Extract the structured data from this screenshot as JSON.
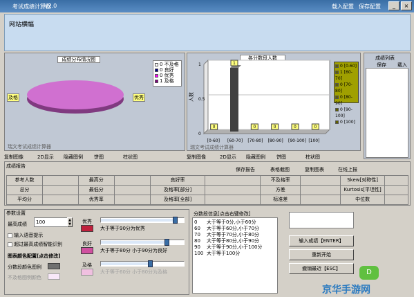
{
  "window": {
    "title": "考试成绩计算器",
    "version": "V2.0",
    "menu_import": "载入配置",
    "menu_save": "保存配置"
  },
  "banner": {
    "text": "网站横幅"
  },
  "pie": {
    "title": "成绩分布情况图",
    "label_left": "及格",
    "label_right": "优秀",
    "credit": "瑞文考试成绩计算器",
    "legend": [
      "0 不及格",
      "0 良好",
      "0 优秀",
      "1 及格"
    ],
    "legend_colors": [
      "#ffffff",
      "#000080",
      "#ff00ff",
      "#800080"
    ],
    "tools": [
      "复制图像",
      "2D显示",
      "隐藏图例",
      "饼图",
      "柱状图"
    ]
  },
  "bar": {
    "title": "各分数段人数",
    "ylabel": "人数",
    "credit": "瑞文考试成绩计算器",
    "tools": [
      "复制图像",
      "2D显示",
      "隐藏图例",
      "饼图",
      "柱状图"
    ]
  },
  "chart_data": {
    "type": "bar",
    "title": "各分数段人数",
    "ylabel": "人数",
    "xlabel": "",
    "categories": [
      "[0-60]",
      "[60-70]",
      "[70-80]",
      "[80-90]",
      "[90-100]",
      "[100]"
    ],
    "values": [
      0,
      1,
      0,
      0,
      0,
      0
    ],
    "ylim": [
      0,
      1
    ],
    "grid": true,
    "legend": [
      "0 [0-60]",
      "1 [60-70]",
      "0 [70-80]",
      "0 [80-90]",
      "0 [90-100]",
      "0 [100]"
    ]
  },
  "side": {
    "title": "成绩列表",
    "col1": "保存",
    "col2": "载入"
  },
  "report": {
    "title": "成绩报告",
    "save": "保存报告",
    "format": "表格截图",
    "copy": "复制图表",
    "online": "在线上报",
    "rows": [
      [
        "参考人数",
        "",
        "最高分",
        "",
        "良好率",
        "",
        "不及格率",
        "",
        "Skew[对称性]",
        ""
      ],
      [
        "总分",
        "",
        "最低分",
        "",
        "及格率[部分]",
        "",
        "方差",
        "",
        "Kurtosis[平坦性]",
        ""
      ],
      [
        "平均分",
        "",
        "优秀率",
        "",
        "及格率[全部]",
        "",
        "标准差",
        "",
        "中位数",
        ""
      ]
    ]
  },
  "params": {
    "title": "参数设置",
    "max_label": "最高成绩",
    "max_value": "100",
    "voice": "输入语音提示",
    "smart": "超过最高成绩智能识别",
    "color_title": "图表颜色配置[点击修改]",
    "group_color": "分数段颜色图例",
    "fail_color": "不及格图例颜色",
    "excellent": "优秀",
    "excellent_desc": "大于等于90分为优秀",
    "good": "良好",
    "good_desc": "大于等于80分 小于90分为良好",
    "pass": "及格",
    "pass_desc": "大于等于60分 小于80分为及格",
    "levels": {
      "excellent": 0.9,
      "good": 0.8,
      "pass": 0.6
    }
  },
  "ranges": {
    "title": "分数段信息[点击右键修改]",
    "rows": [
      [
        "0",
        "大于等于0分,小于60分"
      ],
      [
        "60",
        "大于等于60分,小于70分"
      ],
      [
        "70",
        "大于等于70分,小于80分"
      ],
      [
        "80",
        "大于等于80分,小于90分"
      ],
      [
        "90",
        "大于等于90分,小于100分"
      ],
      [
        "100",
        "大于等于100分"
      ]
    ]
  },
  "actions": {
    "enter": "输入成绩【ENTER】",
    "restart": "重新开始",
    "undo": "撤销最近【ESC】"
  },
  "watermark": "京华手游网"
}
